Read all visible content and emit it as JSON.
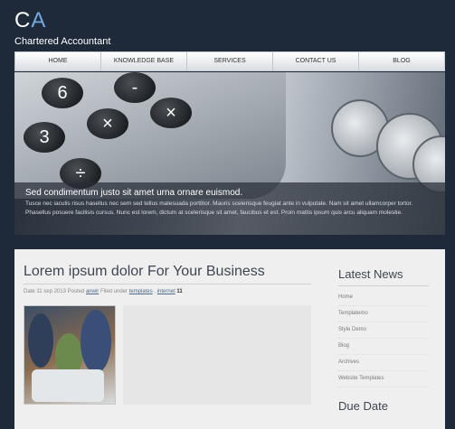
{
  "logo": {
    "mark_c": "C",
    "mark_a": "A",
    "subtitle": "Chartered Accountant"
  },
  "nav": [
    "HOME",
    "KNOWLEDGE BASE",
    "SERVICES",
    "CONTACT US",
    "BLOG"
  ],
  "hero": {
    "title": "Sed condimentum justo sit amet urna ornare euismod.",
    "text": "Tusce nec iaculis risus hasellus nec sem sed tellus malesuada porttitor. Mauris scelerisque feugiat ante in vulputate. Nam sit amet ullamcorper tortor. Phasellus posuere facilisis cursus. Nunc est lorem, dictum at scelerisque sit amet, faucibus et est. Proin mattis ipsum quis arcu aliquam molestie."
  },
  "post": {
    "title": "Lorem ipsum dolor For Your Business",
    "date": "Date 11 sep 2013",
    "posted_label": "Posted",
    "author": "anwir",
    "filed_label": "Filed under",
    "category1": "templates",
    "category2": "internet",
    "comments": "11"
  },
  "sidebar": {
    "title": "Latest News",
    "items": [
      "Home",
      "Templatemo",
      "Style Demo",
      "Blog",
      "Archives",
      "Website Templates"
    ],
    "title2": "Due Date"
  },
  "colors": {
    "background": "#1e2a3a",
    "accent": "#6fa8e0",
    "content_bg": "#efefef"
  }
}
